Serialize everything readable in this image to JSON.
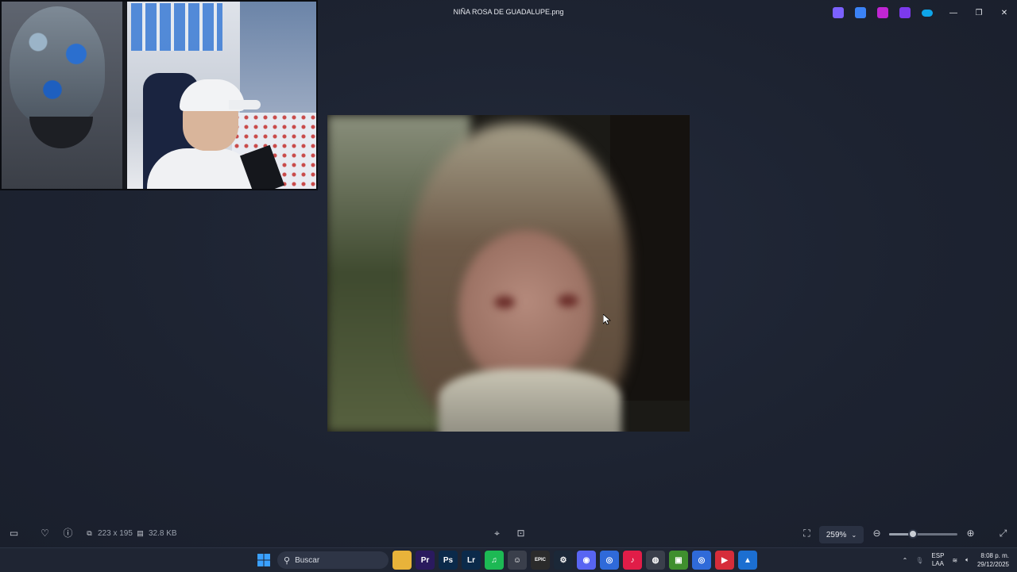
{
  "window": {
    "title": "NIÑA ROSA DE GUADALUPE.png",
    "minimize": "—",
    "maximize": "❐",
    "close": "✕"
  },
  "title_apps": [
    {
      "name": "copilot-icon",
      "color": "#7b61ff"
    },
    {
      "name": "edit-icon",
      "color": "#3b82f6"
    },
    {
      "name": "designer-icon",
      "color": "#c026d3"
    },
    {
      "name": "clipchamp-icon",
      "color": "#7c3aed"
    },
    {
      "name": "onedrive-icon",
      "color": "#0ea5e9"
    }
  ],
  "image_info": {
    "dimensions": "223 x 195",
    "file_size": "32.8 KB"
  },
  "zoom": {
    "level": "259%",
    "slider_fraction": 0.35
  },
  "taskbar": {
    "search_label": "Buscar",
    "apps": [
      {
        "id": "file-explorer",
        "glyph": "",
        "color": "#e8b33a"
      },
      {
        "id": "premiere",
        "glyph": "Pr",
        "color": "#2a1a5e"
      },
      {
        "id": "photoshop",
        "glyph": "Ps",
        "color": "#0b2a4a"
      },
      {
        "id": "lightroom",
        "glyph": "Lr",
        "color": "#0b2a4a"
      },
      {
        "id": "spotify",
        "glyph": "♫",
        "color": "#1db954"
      },
      {
        "id": "app-bot",
        "glyph": "☺",
        "color": "#3a3f4b"
      },
      {
        "id": "epic",
        "glyph": "EPIC",
        "color": "#2b2b2b"
      },
      {
        "id": "steam",
        "glyph": "⚙",
        "color": "#1b2838"
      },
      {
        "id": "discord",
        "glyph": "◉",
        "color": "#5865f2"
      },
      {
        "id": "chrome",
        "glyph": "◎",
        "color": "#2f6ad9"
      },
      {
        "id": "tiktok",
        "glyph": "♪",
        "color": "#e11d48"
      },
      {
        "id": "obs",
        "glyph": "◍",
        "color": "#3a3f4b"
      },
      {
        "id": "minecraft",
        "glyph": "▣",
        "color": "#3f8f2e"
      },
      {
        "id": "chrome-2",
        "glyph": "◎",
        "color": "#2f6ad9"
      },
      {
        "id": "capcut",
        "glyph": "▶",
        "color": "#d62d3a"
      },
      {
        "id": "photos",
        "glyph": "▲",
        "color": "#1c6fd1"
      }
    ],
    "tray": {
      "lang_line1": "ESP",
      "lang_line2": "LAA",
      "time": "8:08 p. m.",
      "date": "29/12/2025"
    }
  }
}
